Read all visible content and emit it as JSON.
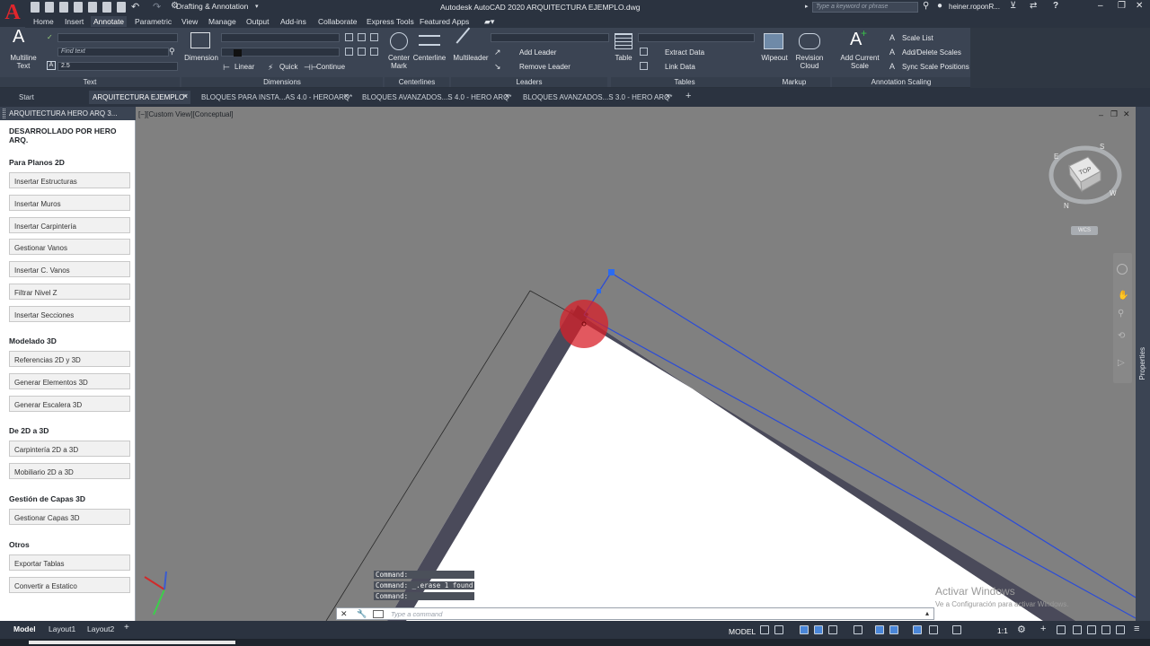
{
  "app": {
    "logo": "A",
    "workspace": "Drafting & Annotation",
    "title": "Autodesk AutoCAD 2020   ARQUITECTURA EJEMPLO.dwg",
    "search_placeholder": "Type a keyword or phrase",
    "user": "heiner.roponR...",
    "help": "?"
  },
  "menu": [
    "Home",
    "Insert",
    "Annotate",
    "Parametric",
    "View",
    "Manage",
    "Output",
    "Add-ins",
    "Collaborate",
    "Express Tools",
    "Featured Apps"
  ],
  "active_menu": "Annotate",
  "ribbon": {
    "text_panel": {
      "multiline": "Multiline Text",
      "find_placeholder": "Find text",
      "height": "2.5",
      "title": "Text"
    },
    "dimensions_panel": {
      "dimension": "Dimension",
      "linear": "Linear",
      "quick": "Quick",
      "continue": "Continue",
      "title": "Dimensions"
    },
    "centerlines_panel": {
      "center_mark": "Center Mark",
      "centerline": "Centerline",
      "title": "Centerlines"
    },
    "leaders_panel": {
      "multileader": "Multileader",
      "add_leader": "Add Leader",
      "remove_leader": "Remove Leader",
      "title": "Leaders"
    },
    "tables_panel": {
      "table": "Table",
      "extract_data": "Extract Data",
      "link_data": "Link Data",
      "title": "Tables"
    },
    "markup_panel": {
      "wipeout": "Wipeout",
      "revision_cloud": "Revision Cloud",
      "title": "Markup"
    },
    "annotation_scaling_panel": {
      "add_current_scale": "Add Current Scale",
      "scale_list": "Scale List",
      "add_delete_scales": "Add/Delete Scales",
      "sync_scale_positions": "Sync Scale Positions",
      "title": "Annotation Scaling"
    }
  },
  "doc_tabs": [
    "Start",
    "ARQUITECTURA EJEMPLO*",
    "BLOQUES PARA INSTA...AS 4.0 - HEROARQ*",
    "BLOQUES AVANZADOS...S 4.0 - HERO ARQ*",
    "BLOQUES AVANZADOS...S 3.0 - HERO ARQ*"
  ],
  "active_doc_tab": "ARQUITECTURA EJEMPLO*",
  "palette": {
    "header": "ARQUITECTURA HERO ARQ 3...",
    "credit": "DESARROLLADO POR HERO ARQ.",
    "sections": [
      {
        "title": "Para Planos 2D",
        "buttons": [
          "Insertar Estructuras",
          "Insertar Muros",
          "Insertar Carpintería",
          "Gestionar Vanos",
          "Insertar C. Vanos",
          "Filtrar Nivel Z",
          "Insertar Secciones"
        ]
      },
      {
        "title": "Modelado 3D",
        "buttons": [
          "Referencias 2D y 3D",
          "Generar Elementos 3D",
          "Generar Escalera 3D"
        ]
      },
      {
        "title": "De 2D a 3D",
        "buttons": [
          "Carpintería 2D a 3D",
          "Mobiliario 2D a 3D"
        ]
      },
      {
        "title": "Gestión de Capas 3D",
        "buttons": [
          "Gestionar Capas 3D"
        ]
      },
      {
        "title": "Otros",
        "buttons": [
          "Exportar Tablas",
          "Convertir a Estatico"
        ]
      }
    ]
  },
  "viewport": {
    "label": "[−][Custom View][Conceptual]",
    "viewcube": {
      "face": "TOP",
      "n": "N",
      "s": "S",
      "e": "E",
      "w": "W",
      "wcs": "WCS"
    },
    "colors": {
      "background": "#808080",
      "selection": "#2a4bd8",
      "wall": "#4a4a5a",
      "highlight": "#d8202a"
    }
  },
  "command": {
    "history": [
      "Command:",
      "Command: _.erase 1 found",
      "Command:"
    ],
    "placeholder": "Type a command"
  },
  "properties_label": "Properties",
  "watermark": {
    "line1": "Activar Windows",
    "line2": "Ve a Configuración para activar Windows."
  },
  "layout_tabs": [
    "Model",
    "Layout1",
    "Layout2"
  ],
  "status": {
    "model": "MODEL",
    "scale": "1:1"
  }
}
